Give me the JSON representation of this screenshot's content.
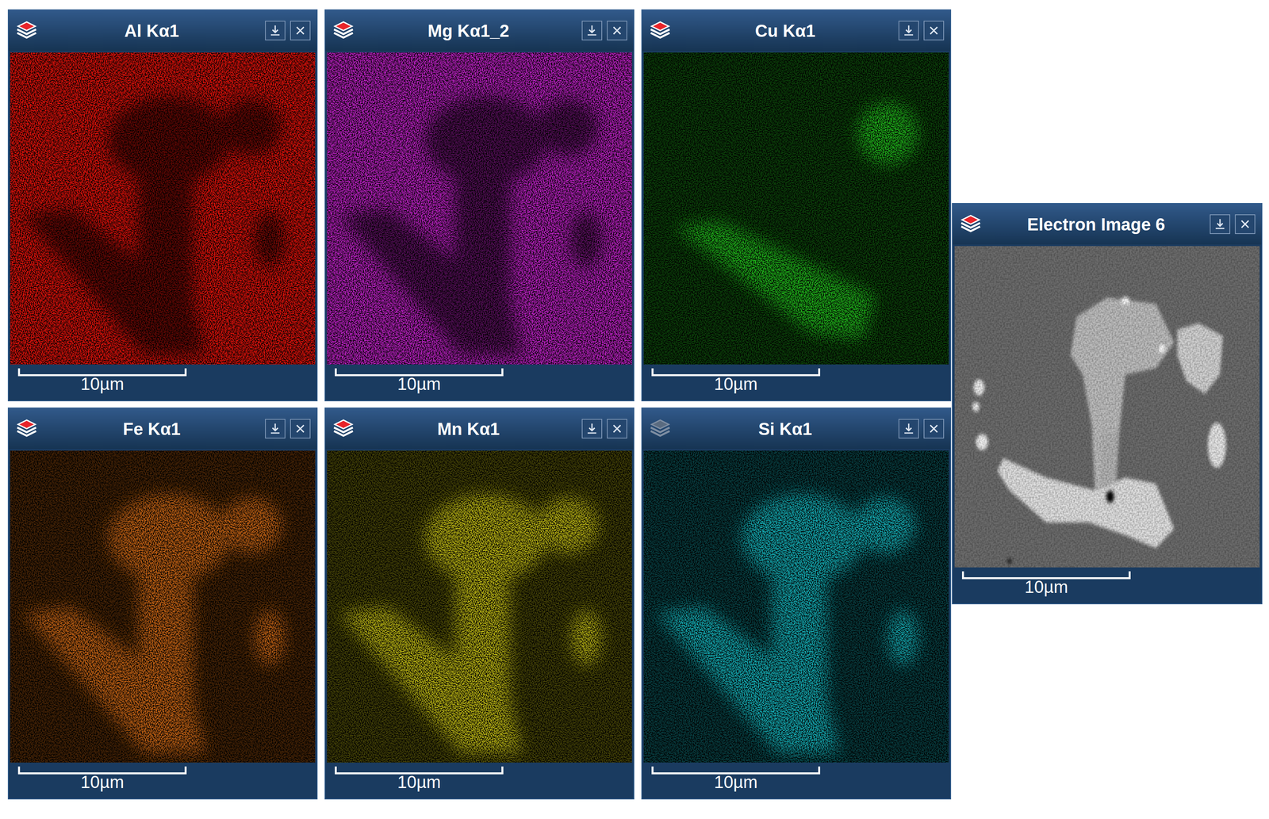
{
  "maps": [
    {
      "title": "Al Kα1",
      "color": "#e3120b",
      "kind": "depleted",
      "layers_active": true,
      "scale": "10µm"
    },
    {
      "title": "Mg Kα1_2",
      "color": "#c022c8",
      "kind": "depleted",
      "layers_active": true,
      "scale": "10µm"
    },
    {
      "title": "Cu Kα1",
      "color": "#22c01e",
      "kind": "enriched",
      "layers_active": true,
      "scale": "10µm"
    },
    {
      "title": "Fe Kα1",
      "color": "#d26a12",
      "kind": "enriched",
      "layers_active": true,
      "scale": "10µm"
    },
    {
      "title": "Mn Kα1",
      "color": "#c8c214",
      "kind": "enriched",
      "layers_active": true,
      "scale": "10µm"
    },
    {
      "title": "Si Kα1",
      "color": "#18b8c0",
      "kind": "enriched",
      "layers_active": false,
      "scale": "10µm"
    }
  ],
  "electron_image": {
    "title": "Electron Image 6",
    "layers_active": true,
    "scale": "10µm"
  }
}
